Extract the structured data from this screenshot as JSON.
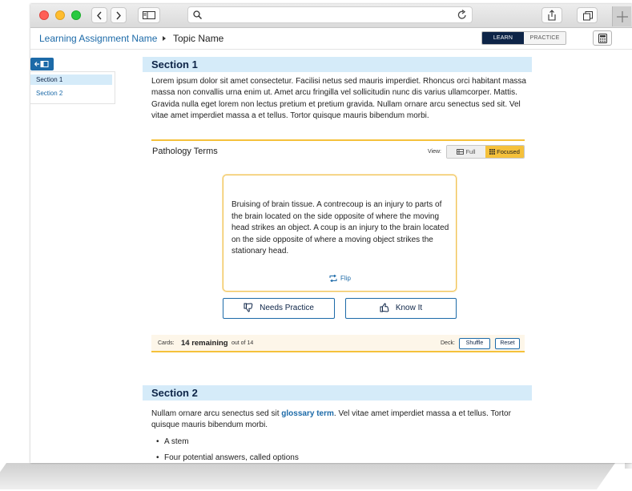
{
  "header": {
    "breadcrumb_link": "Learning Assignment Name",
    "topic": "Topic Name",
    "mode_learn": "LEARN",
    "mode_practice": "PRACTICE"
  },
  "sidebar": {
    "items": [
      {
        "label": "Section 1",
        "active": true
      },
      {
        "label": "Section 2",
        "active": false
      }
    ]
  },
  "section1": {
    "title": "Section 1",
    "body": "Lorem ipsum dolor sit amet consectetur. Facilisi netus sed mauris imperdiet. Rhoncus orci habitant massa massa non convallis urna enim ut. Amet arcu fringilla vel sollicitudin nunc dis varius ullamcorper. Mattis. Gravida nulla eget lorem non lectus pretium et pretium gravida. Nullam ornare arcu senectus sed sit. Vel vitae amet imperdiet massa a et tellus. Tortor quisque mauris bibendum morbi."
  },
  "flashcards": {
    "title": "Pathology Terms",
    "view_label": "View:",
    "view_full": "Full",
    "view_focused": "Focused",
    "card_text": "Bruising of brain tissue. A contrecoup is an injury to parts of the brain located on the side opposite of where the moving head strikes an object. A coup is an injury to the brain located on the side opposite of where a moving object strikes the stationary head.",
    "flip_label": "Flip",
    "needs_practice_label": "Needs Practice",
    "know_it_label": "Know It",
    "cards_label": "Cards:",
    "remaining": "14 remaining",
    "out_of": "out of 14",
    "deck_label": "Deck:",
    "shuffle_label": "Shuffle",
    "reset_label": "Reset"
  },
  "section2": {
    "title": "Section 2",
    "body_before": "Nullam ornare arcu senectus sed sit ",
    "glossary_term": "glossary term",
    "body_after": ". Vel vitae amet imperdiet massa a et tellus. Tortor quisque mauris bibendum morbi.",
    "bullets": [
      "A stem",
      "Four potential answers, called options"
    ]
  },
  "colors": {
    "accent": "#1c6aa8",
    "navy": "#0d2447",
    "section_bg": "#d5ebf9",
    "highlight": "#f5c13b"
  },
  "icons": [
    "search-icon",
    "reload-icon",
    "share-icon",
    "tabs-icon",
    "plus-icon",
    "sidebar-icon",
    "calculator-icon",
    "collapse-sidebar-icon",
    "grid-icon",
    "focused-grid-icon",
    "flip-icon",
    "thumbs-down-icon",
    "thumbs-up-icon"
  ]
}
